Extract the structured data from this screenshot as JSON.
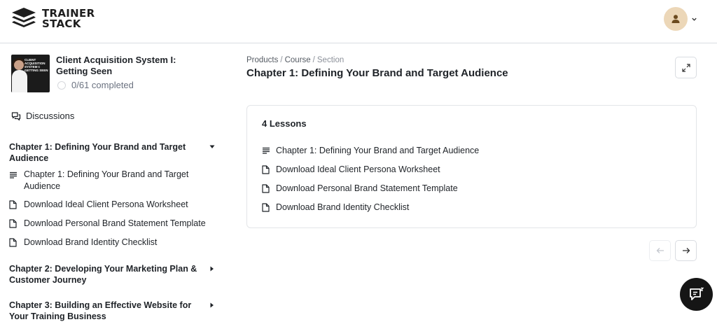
{
  "brand": {
    "line1": "TRAINER",
    "line2": "STACK"
  },
  "header": {
    "avatar_icon": "user-icon",
    "menu_icon": "chevron-down-icon"
  },
  "sidebar": {
    "course": {
      "title": "Client Acquisition System I: Getting Seen",
      "progress": "0/61 completed",
      "thumbnail_text": "CLIENT ACQUISITION SYSTEM I: GETTING SEEN"
    },
    "discussions_label": "Discussions",
    "chapters": [
      {
        "title": "Chapter 1: Defining Your Brand and Target Audience",
        "expanded": true,
        "lessons": [
          {
            "label": "Chapter 1: Defining Your Brand and Target Audience",
            "icon": "text-lines-icon"
          },
          {
            "label": "Download Ideal Client Persona Worksheet",
            "icon": "document-icon"
          },
          {
            "label": "Download Personal Brand Statement Template",
            "icon": "document-icon"
          },
          {
            "label": "Download Brand Identity Checklist",
            "icon": "document-icon"
          }
        ]
      },
      {
        "title": "Chapter 2: Developing Your Marketing Plan & Customer Journey",
        "expanded": false
      },
      {
        "title": "Chapter 3: Building an Effective Website for Your Training Business",
        "expanded": false
      }
    ]
  },
  "main": {
    "breadcrumb": [
      "Products",
      "Course",
      "Section"
    ],
    "title": "Chapter 1: Defining Your Brand and Target Audience",
    "lessons_count_label": "4 Lessons",
    "lessons": [
      {
        "label": "Chapter 1: Defining Your Brand and Target Audience",
        "icon": "text-lines-icon"
      },
      {
        "label": "Download Ideal Client Persona Worksheet",
        "icon": "document-icon"
      },
      {
        "label": "Download Personal Brand Statement Template",
        "icon": "document-icon"
      },
      {
        "label": "Download Brand Identity Checklist",
        "icon": "document-icon"
      }
    ]
  },
  "colors": {
    "text": "#1f2328",
    "border": "#d9dce1",
    "avatar_bg": "#ecd7b8",
    "fab_bg": "#151515"
  }
}
